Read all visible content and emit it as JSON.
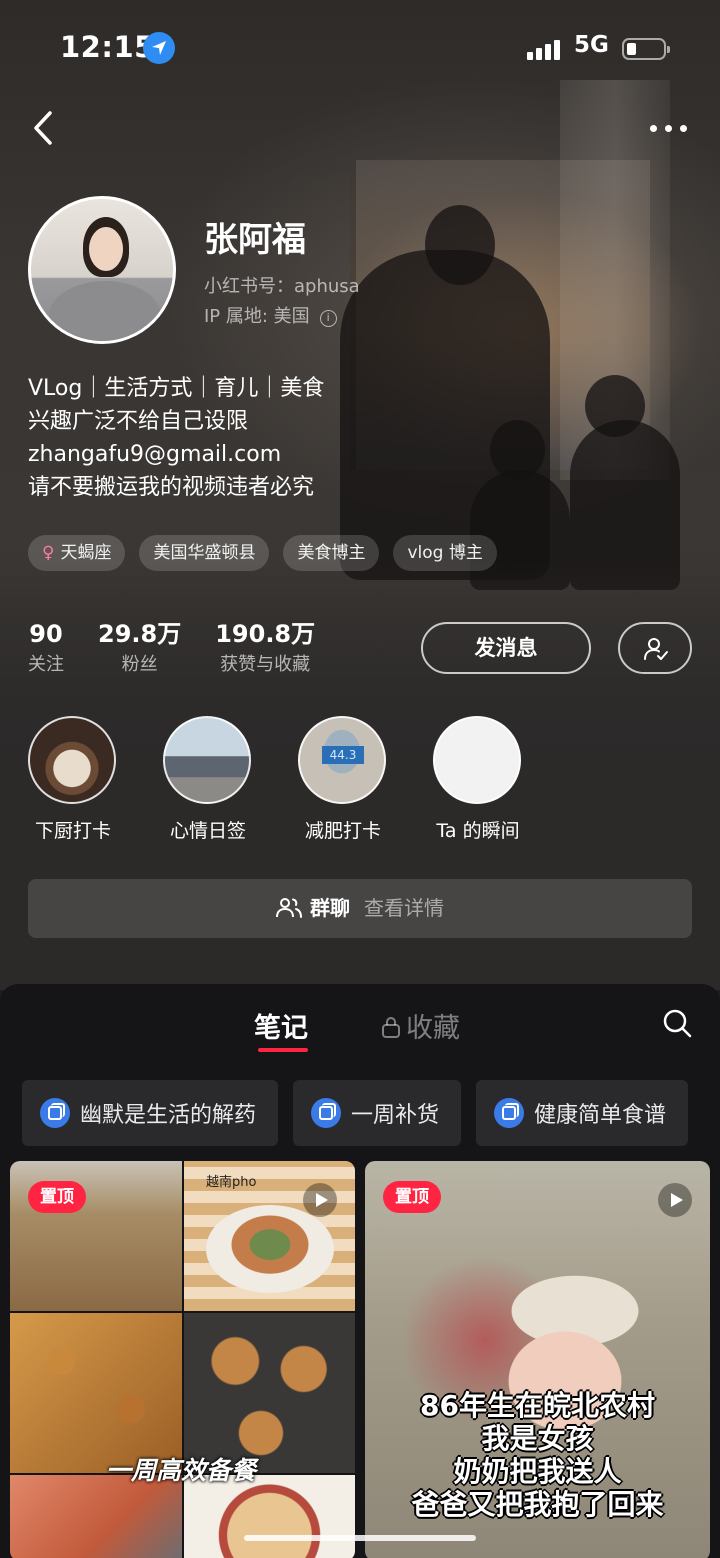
{
  "status_bar": {
    "time": "12:15",
    "network": "5G"
  },
  "profile": {
    "name": "张阿福",
    "red_id": "小红书号：aphusa",
    "ip_location": "IP 属地: 美国",
    "bio_lines": [
      "VLog｜生活方式｜育儿｜美食",
      "兴趣广泛不给自己设限",
      "zhangafu9@gmail.com",
      "请不要搬运我的视频违者必究"
    ],
    "tags": [
      "天蝎座",
      "美国华盛顿县",
      "美食博主",
      "vlog 博主"
    ]
  },
  "stats": [
    {
      "value": "90",
      "label": "关注"
    },
    {
      "value": "29.8万",
      "label": "粉丝"
    },
    {
      "value": "190.8万",
      "label": "获赞与收藏"
    }
  ],
  "actions": {
    "message": "发消息"
  },
  "highlights": [
    {
      "label": "下厨打卡",
      "overlay": ""
    },
    {
      "label": "心情日签",
      "overlay": ""
    },
    {
      "label": "减肥打卡",
      "overlay": "44.3"
    },
    {
      "label": "Ta 的瞬间",
      "overlay": ""
    }
  ],
  "group_chat": {
    "label": "群聊",
    "detail": "查看详情"
  },
  "tabs": {
    "notes": "笔记",
    "favorites": "收藏"
  },
  "albums": [
    "幽默是生活的解药",
    "一周补货",
    "健康简单食谱"
  ],
  "posts": [
    {
      "badge": "置顶",
      "image_text": "越南pho",
      "caption": "一周高效备餐"
    },
    {
      "badge": "置顶",
      "caption_lines": [
        "86年生在皖北农村",
        "我是女孩",
        "奶奶把我送人",
        "爸爸又把我抱了回来"
      ]
    }
  ],
  "colors": {
    "accent": "#ff2442",
    "location": "#2f8cf3",
    "album_icon": "#3b7be8"
  }
}
